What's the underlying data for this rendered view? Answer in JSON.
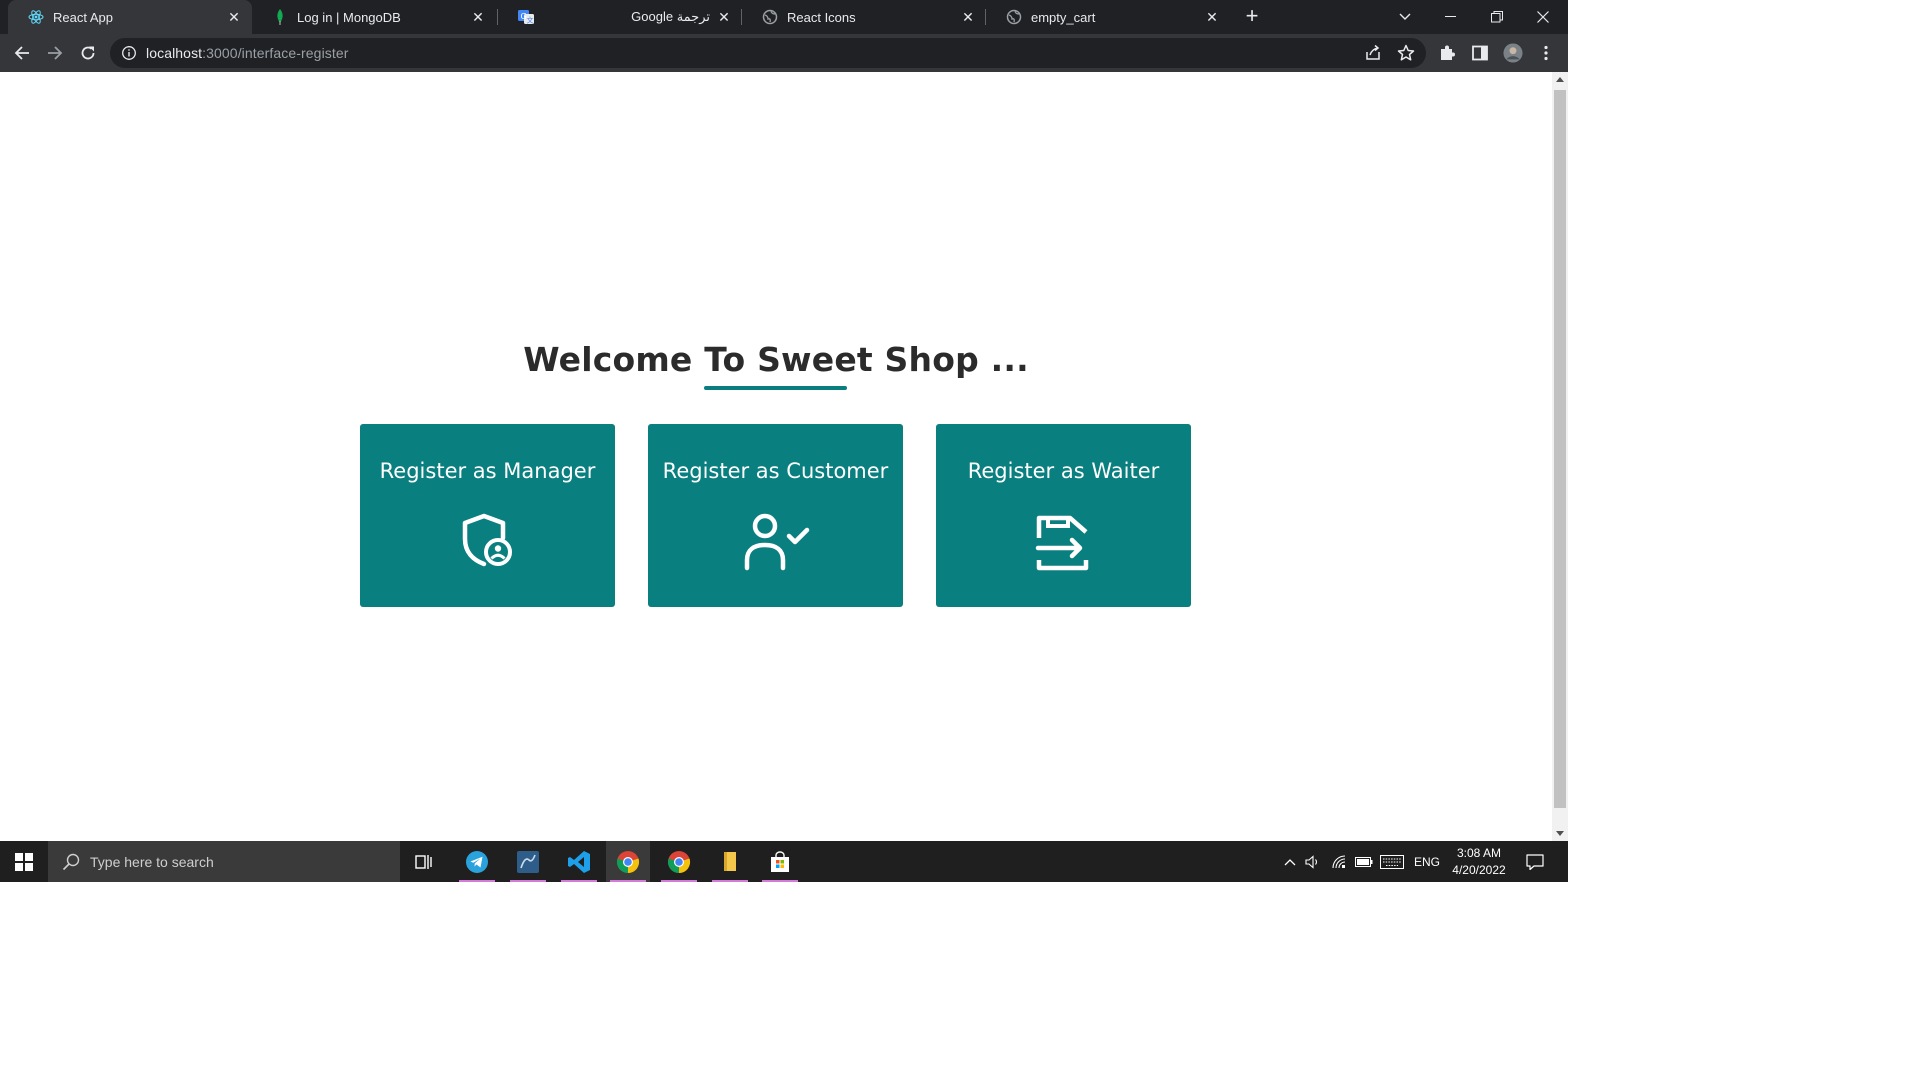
{
  "browser": {
    "tabs": [
      {
        "title": "React App",
        "icon": "react-icon",
        "active": true
      },
      {
        "title": "Log in | MongoDB",
        "icon": "mongodb-leaf-icon",
        "active": false
      },
      {
        "title": "Google ترجمة",
        "icon": "google-translate-icon",
        "active": false
      },
      {
        "title": "React Icons",
        "icon": "globe-icon",
        "active": false
      },
      {
        "title": "empty_cart",
        "icon": "globe-icon",
        "active": false
      }
    ],
    "url_host": "localhost",
    "url_path": ":3000/interface-register"
  },
  "page": {
    "heading": "Welcome To Sweet Shop ...",
    "accent_color": "#0a7f7f",
    "cards": [
      {
        "label": "Register as Manager",
        "icon": "shield-user-icon"
      },
      {
        "label": "Register as Customer",
        "icon": "user-check-icon"
      },
      {
        "label": "Register as Waiter",
        "icon": "transfer-box-icon"
      }
    ]
  },
  "taskbar": {
    "search_placeholder": "Type here to search",
    "apps": [
      "task-view-icon",
      "telegram-icon",
      "mysql-workbench-icon",
      "vscode-icon",
      "chrome-icon",
      "chrome-icon",
      "file-explorer-icon",
      "store-icon"
    ],
    "language": "ENG",
    "time": "3:08 AM",
    "date": "4/20/2022"
  }
}
